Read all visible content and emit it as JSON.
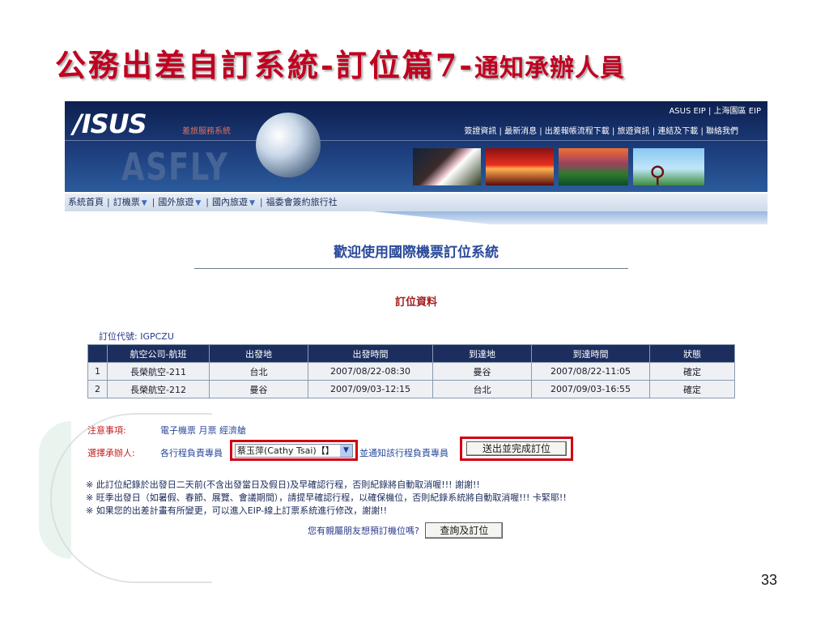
{
  "slide": {
    "title_main": "公務出差自訂系統-訂位篇7-",
    "title_sub": "通知承辦人員",
    "page_number": "33"
  },
  "header": {
    "logo": "/ISUS",
    "logo_sub": "差旅服務系統",
    "asfly": "ASFLY",
    "top_links": "ASUS EIP | 上海園區 EIP",
    "nav_links": "簽證資訊 | 最新消息 | 出差報帳流程下載 | 旅遊資訊 | 連結及下載 | 聯絡我們"
  },
  "menu": {
    "home": "系統首頁",
    "tickets": "訂機票",
    "intl_travel": "國外旅遊",
    "domestic_travel": "國內旅遊",
    "welfare": "福委會簽約旅行社"
  },
  "main": {
    "page_heading": "歡迎使用國際機票訂位系統",
    "section_heading": "訂位資料",
    "pnr_label": "訂位代號: IGPCZU"
  },
  "table": {
    "headers": [
      "",
      "航空公司-航班",
      "出發地",
      "出發時間",
      "到達地",
      "到達時間",
      "狀態"
    ],
    "rows": [
      [
        "1",
        "長榮航空-211",
        "台北",
        "2007/08/22-08:30",
        "曼谷",
        "2007/08/22-11:05",
        "確定"
      ],
      [
        "2",
        "長榮航空-212",
        "曼谷",
        "2007/09/03-12:15",
        "台北",
        "2007/09/03-16:55",
        "確定"
      ]
    ]
  },
  "notes": {
    "notice_label": "注意事項:",
    "notice_value": "電子機票 月票 經濟艙",
    "assignee_label": "選擇承辦人:",
    "assignee_prefix": "各行程負責專員",
    "assignee_selected": "蔡玉萍(Cathy Tsai)【】",
    "assignee_suffix": "並通知該行程負責專員",
    "submit_label": "送出並完成訂位"
  },
  "remarks": [
    "※ 此訂位紀錄於出發日二天前(不含出發當日及假日)及早確認行程，否則紀錄將自動取消喔!!! 謝謝!!",
    "※ 旺季出發日（如暑假、春節、展覽、會議期間），請提早確認行程，以確保機位，否則紀錄系統將自動取消喔!!! 卡緊耶!!",
    "※ 如果您的出差計畫有所變更，可以進入EIP-線上訂票系統進行修改，謝謝!!"
  ],
  "query": {
    "prompt": "您有親屬朋友想預訂機位嗎?",
    "button_label": "查詢及訂位"
  },
  "colors": {
    "title_red": "#c00020",
    "banner_navy": "#1d3e7d",
    "table_header": "#1c2e5e",
    "highlight_red": "#d00010"
  }
}
